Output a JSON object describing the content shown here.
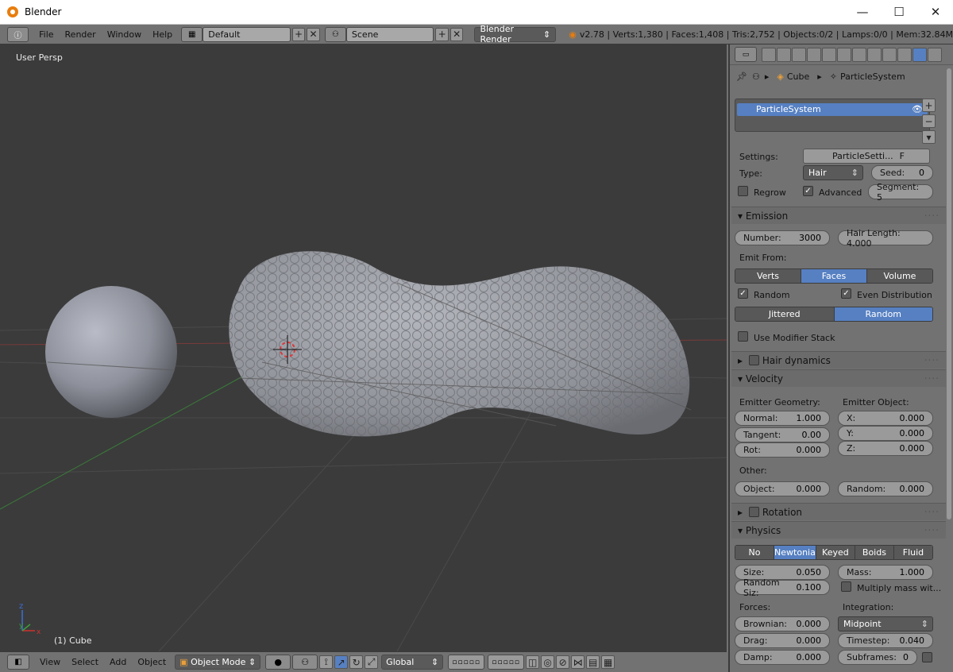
{
  "window": {
    "title": "Blender",
    "minimize": "—",
    "maximize": "☐",
    "close": "✕"
  },
  "menubar": {
    "menus": [
      "File",
      "Render",
      "Window",
      "Help"
    ],
    "screen_layout": "Default",
    "scene": "Scene",
    "engine": "Blender Render",
    "stats": "v2.78 | Verts:1,380 | Faces:1,408 | Tris:2,752 | Objects:0/2 | Lamps:0/0 | Mem:32.84M"
  },
  "viewport": {
    "view_label": "User Persp",
    "object_label": "(1) Cube",
    "axis_z": "z",
    "axis_y": "y",
    "axis_x": "x"
  },
  "footer": {
    "menus": [
      "View",
      "Select",
      "Add",
      "Object"
    ],
    "mode": "Object Mode",
    "orientation": "Global"
  },
  "properties": {
    "breadcrumb": {
      "object": "Cube",
      "system": "ParticleSystem"
    },
    "list_item": "ParticleSystem",
    "settings_label": "Settings:",
    "settings_value": "ParticleSetti...",
    "settings_f": "F",
    "type_label": "Type:",
    "type_value": "Hair",
    "seed_label": "Seed:",
    "seed_value": "0",
    "regrow": "Regrow",
    "advanced": "Advanced",
    "segment": "Segment: 5",
    "emission": {
      "header": "Emission",
      "number_label": "Number:",
      "number_value": "3000",
      "hair_length": "Hair Length: 4.000",
      "emit_from": "Emit From:",
      "emit_options": [
        "Verts",
        "Faces",
        "Volume"
      ],
      "random": "Random",
      "even_distribution": "Even Distribution",
      "dist_options": [
        "Jittered",
        "Random"
      ],
      "use_modifier_stack": "Use Modifier Stack"
    },
    "hair_dynamics": "Hair dynamics",
    "velocity": {
      "header": "Velocity",
      "emitter_geometry": "Emitter Geometry:",
      "emitter_object": "Emitter Object:",
      "normal_label": "Normal:",
      "normal_value": "1.000",
      "tangent_label": "Tangent:",
      "tangent_value": "0.00",
      "rot_label": "Rot:",
      "rot_value": "0.000",
      "x_label": "X:",
      "x_value": "0.000",
      "y_label": "Y:",
      "y_value": "0.000",
      "z_label": "Z:",
      "z_value": "0.000",
      "other": "Other:",
      "object_label": "Object:",
      "object_value": "0.000",
      "random_label": "Random:",
      "random_value": "0.000"
    },
    "rotation": "Rotation",
    "physics": {
      "header": "Physics",
      "options": [
        "No",
        "Newtonia",
        "Keyed",
        "Boids",
        "Fluid"
      ],
      "size_label": "Size:",
      "size_value": "0.050",
      "randsize_label": "Random Siz:",
      "randsize_value": "0.100",
      "mass_label": "Mass:",
      "mass_value": "1.000",
      "multiply_mass": "Multiply mass wit...",
      "forces": "Forces:",
      "integration": "Integration:",
      "brownian_label": "Brownian:",
      "brownian_value": "0.000",
      "midpoint": "Midpoint",
      "drag_label": "Drag:",
      "drag_value": "0.000",
      "timestep_label": "Timestep:",
      "timestep_value": "0.040",
      "damp_label": "Damp:",
      "damp_value": "0.000",
      "subframes_label": "Subframes:",
      "subframes_value": "0"
    }
  }
}
